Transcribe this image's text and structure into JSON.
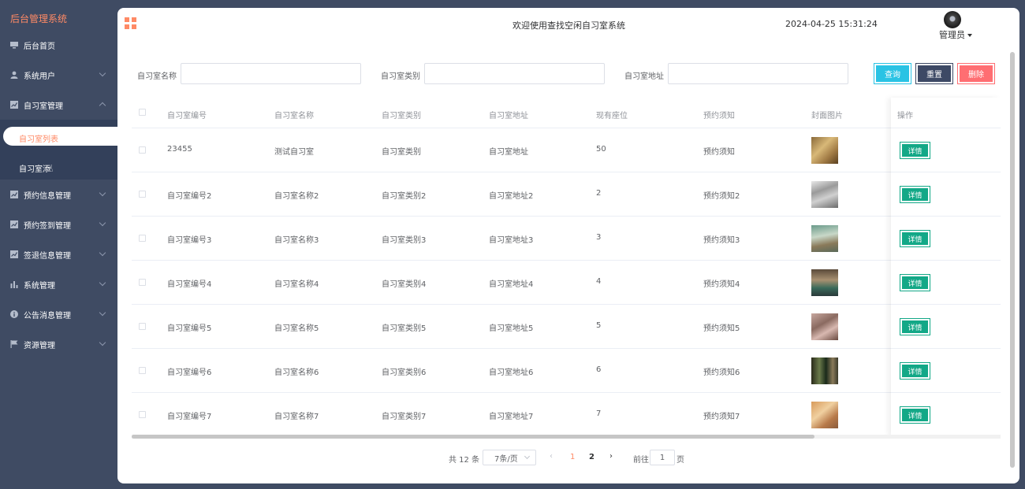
{
  "sidebar": {
    "brand": "后台管理系统",
    "items": [
      {
        "label": "后台首页",
        "icon": "monitor-icon"
      },
      {
        "label": "系统用户",
        "icon": "user-icon"
      },
      {
        "label": "自习室管理",
        "icon": "chart-icon"
      },
      {
        "label": "预约信息管理",
        "icon": "chart-icon"
      },
      {
        "label": "预约签到管理",
        "icon": "chart-icon"
      },
      {
        "label": "签退信息管理",
        "icon": "chart-icon"
      },
      {
        "label": "系统管理",
        "icon": "bar-chart-icon"
      },
      {
        "label": "公告消息管理",
        "icon": "info-icon"
      },
      {
        "label": "资源管理",
        "icon": "flag-icon"
      }
    ],
    "submenu": {
      "active_label": "自习室列表",
      "second_label": "自习室添"
    }
  },
  "header": {
    "welcome": "欢迎使用查找空闲自习室系统",
    "datetime": "2024-04-25 15:31:24",
    "user": "管理员"
  },
  "search": {
    "name_label": "自习室名称",
    "type_label": "自习室类别",
    "address_label": "自习室地址",
    "query": "查询",
    "reset": "重置",
    "delete": "删除"
  },
  "table": {
    "headers": [
      "自习室编号",
      "自习室名称",
      "自习室类别",
      "自习室地址",
      "现有座位",
      "预约须知",
      "封面图片",
      "操作"
    ],
    "detail_label": "详情",
    "rows": [
      [
        "23455",
        "测试自习室",
        "自习室类别",
        "自习室地址",
        "50",
        "预约须知"
      ],
      [
        "自习室编号2",
        "自习室名称2",
        "自习室类别2",
        "自习室地址2",
        "2",
        "预约须知2"
      ],
      [
        "自习室编号3",
        "自习室名称3",
        "自习室类别3",
        "自习室地址3",
        "3",
        "预约须知3"
      ],
      [
        "自习室编号4",
        "自习室名称4",
        "自习室类别4",
        "自习室地址4",
        "4",
        "预约须知4"
      ],
      [
        "自习室编号5",
        "自习室名称5",
        "自习室类别5",
        "自习室地址5",
        "5",
        "预约须知5"
      ],
      [
        "自习室编号6",
        "自习室名称6",
        "自习室类别6",
        "自习室地址6",
        "6",
        "预约须知6"
      ],
      [
        "自习室编号7",
        "自习室名称7",
        "自习室类别7",
        "自习室地址7",
        "7",
        "预约须知7"
      ]
    ]
  },
  "pagination": {
    "total": "共 12 条",
    "page_size": "7条/页",
    "pages": [
      "1",
      "2"
    ],
    "goto": "前往",
    "current": "1",
    "page_unit": "页"
  },
  "colors": {
    "sidebar_bg": "#3f4b63",
    "accent": "#ff8a65",
    "query": "#2ac3e4",
    "reset": "#3d4965",
    "delete": "#ff6e72",
    "detail": "#13a887"
  }
}
